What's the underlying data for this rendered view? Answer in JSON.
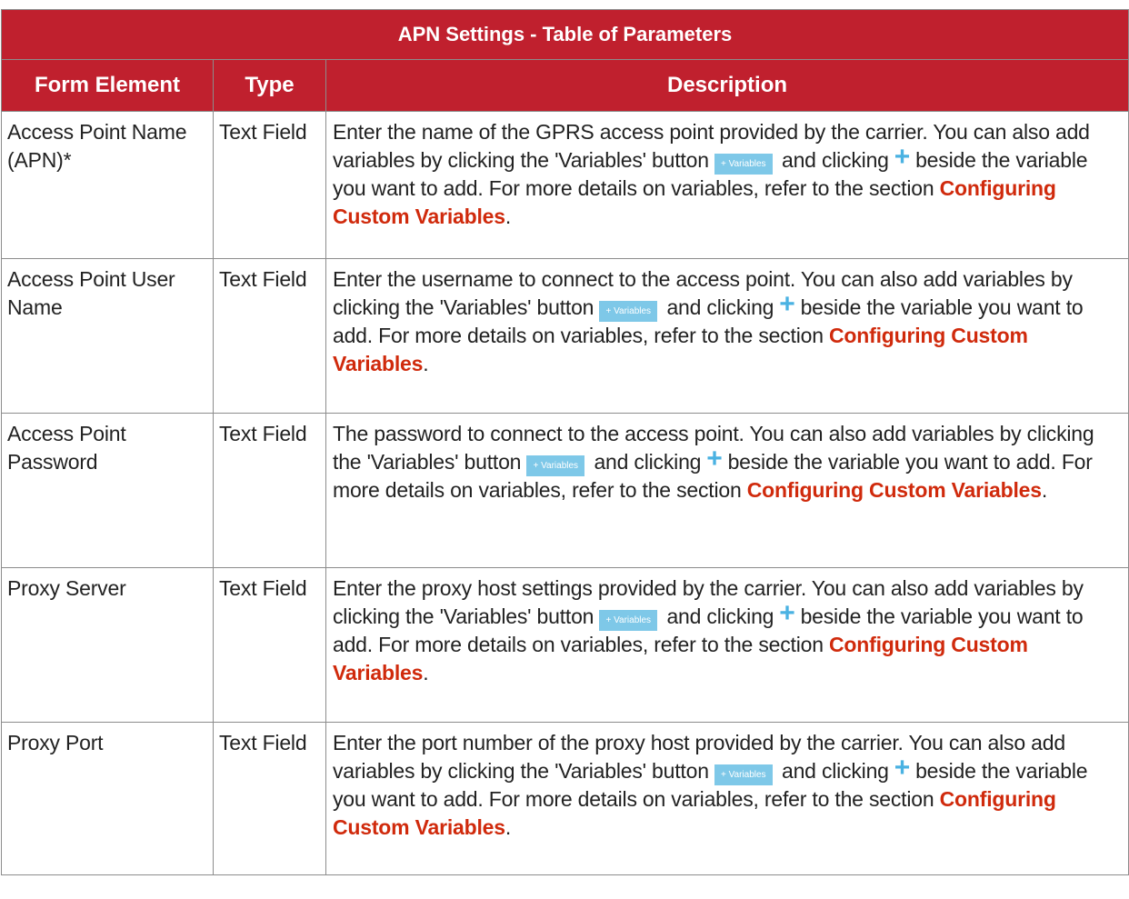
{
  "table": {
    "title": "APN Settings - Table of Parameters",
    "headers": {
      "element": "Form Element",
      "type": "Type",
      "description": "Description"
    },
    "variables_button_label": "+ Variables",
    "plus_glyph": "+",
    "rows": [
      {
        "element": "Access Point Name (APN)*",
        "type": "Text Field",
        "desc_a": "Enter the name of the GPRS access point provided by the carrier. You can also add variables by clicking the 'Variables' button",
        "desc_b": "and clicking",
        "desc_c": "beside the variable you want to add. For more details on variables, refer to the section",
        "link": "Configuring Custom Variables",
        "end": "."
      },
      {
        "element": "Access Point User Name",
        "type": "Text Field",
        "desc_a": "Enter the username to connect to the access point. You can also add variables by clicking the 'Variables' button",
        "desc_b": "and clicking",
        "desc_c": "beside the variable you want to add. For more details on variables, refer to the section",
        "link": "Configuring Custom Variables",
        "end": "."
      },
      {
        "element": "Access Point Password",
        "type": "Text Field",
        "desc_a": "The password to connect to the access point. You can also add variables by clicking the 'Variables' button",
        "desc_b": "and clicking",
        "desc_c": "beside the variable you want to add. For more details on variables, refer to the section",
        "link": "Configuring Custom Variables",
        "end": "."
      },
      {
        "element": "Proxy Server",
        "type": "Text Field",
        "desc_a": "Enter the proxy host settings provided by the carrier. You can also add variables by clicking the 'Variables' button",
        "desc_b": "and clicking",
        "desc_c": "beside the variable you want to add. For more details on variables, refer to the section",
        "link": "Configuring Custom Variables",
        "end": "."
      },
      {
        "element": "Proxy Port",
        "type": "Text Field",
        "desc_a": "Enter the port number of the proxy host provided by the carrier. You can also add variables by clicking the 'Variables' button",
        "desc_b": "and clicking",
        "desc_c": "beside the variable you want to add. For more details on variables, refer to the section",
        "link": "Configuring Custom Variables",
        "end": "."
      }
    ]
  },
  "colors": {
    "header_bg": "#c0202e",
    "link": "#d02a0c",
    "variables_button": "#7ec8e8",
    "plus_icon": "#4ab2e2"
  }
}
